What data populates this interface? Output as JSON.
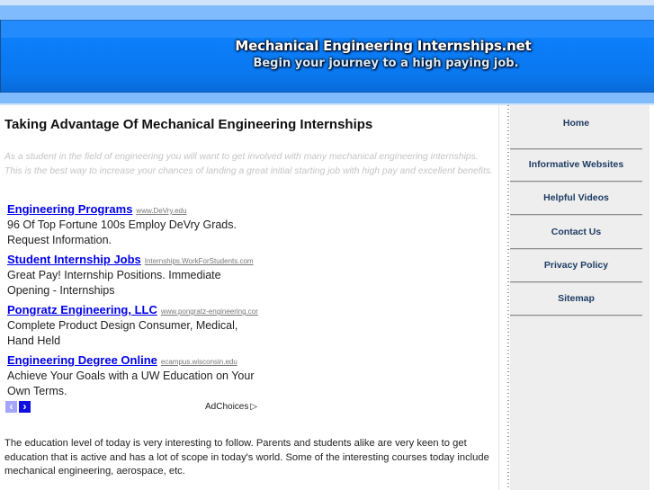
{
  "header": {
    "site_title": "Mechanical Engineering Internships.net",
    "tagline": "Begin your journey to a high paying job."
  },
  "main": {
    "page_title": "Taking Advantage Of Mechanical Engineering Internships",
    "intro_lines": [
      "As a student in the field of engineering you will want to get involved with many mechanical engineering internships.",
      "This is the best way to increase your chances of landing a great initial starting job with high pay and excellent benefits."
    ],
    "ads": [
      {
        "title": "Engineering Programs",
        "url": "www.DeVry.edu",
        "description": "96 Of Top Fortune 100s Employ DeVry Grads. Request Information."
      },
      {
        "title": "Student Internship Jobs",
        "url": "Internships.WorkForStudents.com",
        "description": "Great Pay! Internship Positions. Immediate Opening - Internships"
      },
      {
        "title": "Pongratz Engineering, LLC",
        "url": "www.pongratz-engineering.cor",
        "description": "Complete Product Design Consumer, Medical, Hand Held"
      },
      {
        "title": "Engineering Degree Online",
        "url": "ecampus.wisconsin.edu",
        "description": "Achieve Your Goals with a UW Education on Your Own Terms."
      }
    ],
    "ad_nav": {
      "prev_icon": "chevron-left-icon",
      "next_icon": "chevron-right-icon",
      "prev_glyph": "‹",
      "next_glyph": "›",
      "adchoices_label": "AdChoices",
      "adchoices_glyph": "▷"
    },
    "body_lines": [
      "The education level of today is very interesting to follow. Parents and students alike are very keen to get",
      "education that is active and has a lot of scope in today's world. Some of the interesting courses today include",
      "mechanical engineering, aerospace, etc."
    ]
  },
  "sidebar": {
    "items": [
      {
        "label": "Home"
      },
      {
        "label": "Informative Websites"
      },
      {
        "label": "Helpful Videos"
      },
      {
        "label": "Contact Us"
      },
      {
        "label": "Privacy Policy"
      },
      {
        "label": "Sitemap"
      }
    ]
  },
  "colors": {
    "header_blue": "#0b7ffa",
    "header_light_blue": "#80bcfd",
    "ad_link": "#0000ee",
    "nav_text": "#1e3c64",
    "sidebar_bg": "#eeeeee",
    "intro_text": "#c4c4c4"
  }
}
